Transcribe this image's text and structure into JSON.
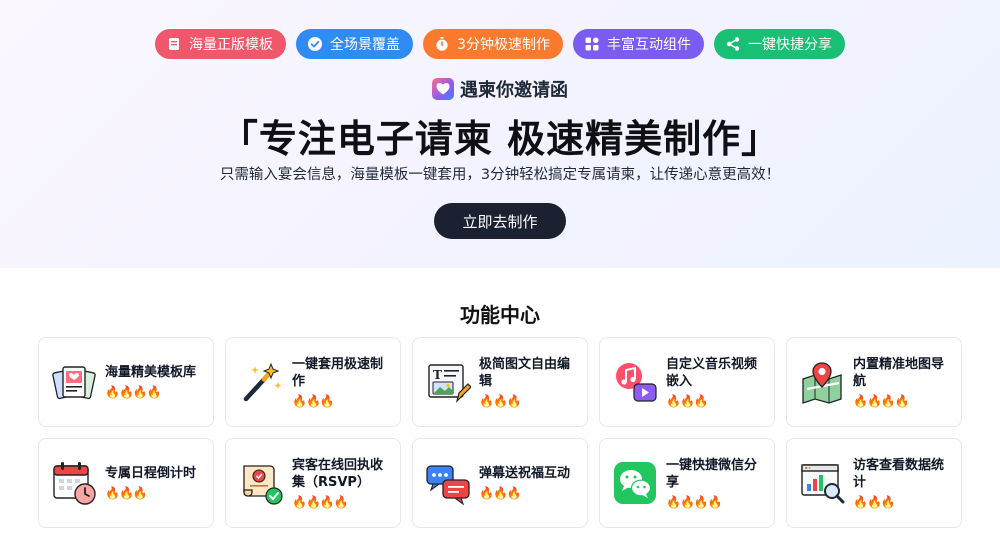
{
  "hero": {
    "pills": [
      {
        "label": "海量正版模板",
        "color": "#f0576a",
        "icon": "template-icon"
      },
      {
        "label": "全场景覆盖",
        "color": "#2f8cf5",
        "icon": "check-circle-icon"
      },
      {
        "label": "3分钟极速制作",
        "color": "#fb7a2e",
        "icon": "stopwatch-icon"
      },
      {
        "label": "丰富互动组件",
        "color": "#7b5cf0",
        "icon": "grid-icon"
      },
      {
        "label": "一键快捷分享",
        "color": "#19bf74",
        "icon": "share-icon"
      }
    ],
    "brand_name": "遇柬你邀请函",
    "title": "「专注电子请柬 极速精美制作」",
    "subtitle": "只需输入宴会信息，海量模板一键套用，3分钟轻松搞定专属请柬，让传递心意更高效！",
    "cta_label": "立即去制作"
  },
  "features": {
    "title": "功能中心",
    "cards": [
      {
        "name": "海量精美模板库",
        "rating": "🔥🔥🔥🔥",
        "icon": "template-gallery-icon"
      },
      {
        "name": "一键套用极速制作",
        "rating": "🔥🔥🔥",
        "icon": "magic-wand-icon"
      },
      {
        "name": "极简图文自由编辑",
        "rating": "🔥🔥🔥",
        "icon": "text-image-edit-icon"
      },
      {
        "name": "自定义音乐视频嵌入",
        "rating": "🔥🔥🔥",
        "icon": "music-video-icon"
      },
      {
        "name": "内置精准地图导航",
        "rating": "🔥🔥🔥🔥",
        "icon": "map-pin-icon"
      },
      {
        "name": "专属日程倒计时",
        "rating": "🔥🔥🔥",
        "icon": "calendar-clock-icon"
      },
      {
        "name": "宾客在线回执收集（RSVP）",
        "rating": "🔥🔥🔥🔥",
        "icon": "rsvp-scroll-icon"
      },
      {
        "name": "弹幕送祝福互动",
        "rating": "🔥🔥🔥",
        "icon": "chat-bubbles-icon"
      },
      {
        "name": "一键快捷微信分享",
        "rating": "🔥🔥🔥🔥",
        "icon": "wechat-icon"
      },
      {
        "name": "访客查看数据统计",
        "rating": "🔥🔥🔥",
        "icon": "analytics-icon"
      }
    ]
  }
}
